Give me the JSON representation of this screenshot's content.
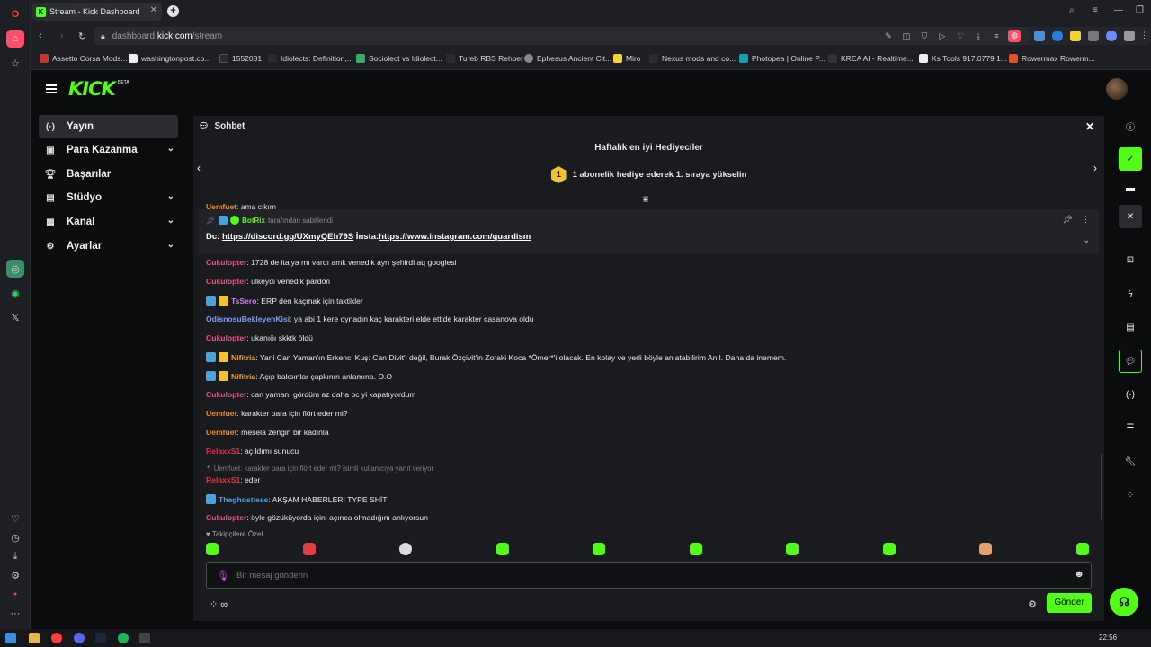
{
  "browser": {
    "tab_title": "Stream - Kick Dashboard",
    "url_prefix": "dashboard.",
    "url_host": "kick.com",
    "url_path": "/stream",
    "bookmarks": [
      "Assetto Corsa Mods...",
      "washingtonpost.co...",
      "1552081",
      "Idiolects: Definition,...",
      "Sociolect vs Idiolect...",
      "Tureb RBS Rehber",
      "Ephesus Ancient Cit...",
      "Miro",
      "Nexus mods and co...",
      "Photopea | Online P...",
      "KREA AI - Realtime...",
      "Ks Tools 917.0779 1...",
      "Rowermax Rowerm..."
    ]
  },
  "kick": {
    "logo": "KICK",
    "beta": "BETA"
  },
  "nav": [
    {
      "label": "Yayın",
      "icon": "broadcast-icon",
      "active": true
    },
    {
      "label": "Para Kazanma",
      "icon": "wallet-icon",
      "chevron": true
    },
    {
      "label": "Başarılar",
      "icon": "trophy-icon"
    },
    {
      "label": "Stüdyo",
      "icon": "studio-icon",
      "chevron": true
    },
    {
      "label": "Kanal",
      "icon": "channel-icon",
      "chevron": true
    },
    {
      "label": "Ayarlar",
      "icon": "gear-icon",
      "chevron": true
    }
  ],
  "chat": {
    "title": "Sohbet",
    "gifters_title": "Haftalık en iyi Hediyeciler",
    "gifters_rank": "1",
    "gifters_text": "1 abonelik hediye ederek 1. sıraya yükselin",
    "partial_user": "Uemfuet",
    "partial_text": ": ama çıkım",
    "pinned": {
      "user": "BotRix",
      "meta": "tarafından sabitlendi",
      "prefix": "Dc: ",
      "link1": "https://discord.gg/UXmyQEh79S",
      "mid": " İnsta:",
      "link2": "https://www.instagram.com/quardism"
    },
    "messages": [
      {
        "user": "Cukulopter",
        "color": "#f0517e",
        "text": ": 1728 de italya mı vardı amk venedik ayrı şehirdi aq googlesi"
      },
      {
        "user": "Cukulopter",
        "color": "#f0517e",
        "text": ": ülkeydi venedik pardon"
      },
      {
        "user": "TsSero",
        "color": "#d277ff",
        "text": ": ERP den kaçmak için taktikler",
        "badges": [
          "#4aa3e0",
          "#f2c230"
        ]
      },
      {
        "user": "OdisnosuBekleyenKisi",
        "color": "#7f9cf5",
        "text": ": ya abi 1 kere oynadın kaç karakteri elde ettide karakter casanova oldu"
      },
      {
        "user": "Cukulopter",
        "color": "#f0517e",
        "text": ": ukanıöı skktk öldü"
      },
      {
        "user": "Nifitria",
        "color": "#f0a030",
        "text": ": Yani Can Yaman'ın Erkenci Kuş: Can Divit'i değil, Burak Özçivit'in Zoraki Koca *Ömer*'i olacak. En kolay ve yerli böyle anlatabilirim Anıl. Daha da inemem.",
        "badges": [
          "#4aa3e0",
          "#f2c230"
        ]
      },
      {
        "user": "Nifitria",
        "color": "#f0a030",
        "text": ": Açıp baksınlar çapkının anlamına. O.O",
        "badges": [
          "#4aa3e0",
          "#f2c230"
        ]
      },
      {
        "user": "Cukulopter",
        "color": "#f0517e",
        "text": ": can yamanı gördüm az daha pc yi kapatıyordum"
      },
      {
        "user": "Uemfuet",
        "color": "#f08a30",
        "text": ": karakter para için flört eder mi?"
      },
      {
        "user": "Uemfuet",
        "color": "#f08a30",
        "text": ": mesela zengin bir kadınla"
      },
      {
        "user": "RelaxxS1",
        "color": "#e0324a",
        "text": ": açıldımı sunucu"
      },
      {
        "user": "RelaxxS1",
        "color": "#e0324a",
        "text": ": eder",
        "reply": "↰ Uemfuet: karakter para için flört eder mi? isimli kullanıcıya yanıt veriyor"
      },
      {
        "user": "Theghostless",
        "color": "#4aa3e0",
        "text": ": AKŞAM HABERLERİ TYPE SHİT",
        "badges": [
          "#4aa3e0"
        ]
      },
      {
        "user": "Cukulopter",
        "color": "#f0517e",
        "text": ": öyle gözüküyorda içini açınca olmadığını anlıyorsun"
      }
    ],
    "emote_label": "Takipçilere Özel",
    "input_placeholder": "Bir mesaj gönderin",
    "send_label": "Gönder",
    "bottom_label": "∞"
  },
  "taskbar": {
    "time": "22:56"
  }
}
